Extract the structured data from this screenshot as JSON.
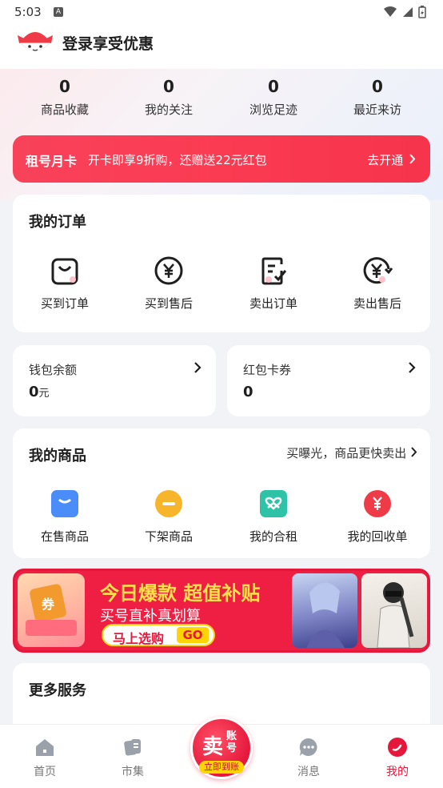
{
  "status": {
    "time": "5:03",
    "badge": "A"
  },
  "header": {
    "title": "登录享受优惠"
  },
  "stats": [
    {
      "value": "0",
      "label": "商品收藏"
    },
    {
      "value": "0",
      "label": "我的关注"
    },
    {
      "value": "0",
      "label": "浏览足迹"
    },
    {
      "value": "0",
      "label": "最近来访"
    }
  ],
  "vip": {
    "title": "租号月卡",
    "desc": "开卡即享9折购，还赠送22元红包",
    "button": "去开通"
  },
  "orders": {
    "title": "我的订单",
    "items": [
      {
        "label": "买到订单",
        "icon": "shopping-bag-icon"
      },
      {
        "label": "买到售后",
        "icon": "yuan-circle-icon"
      },
      {
        "label": "卖出订单",
        "icon": "document-check-icon"
      },
      {
        "label": "卖出售后",
        "icon": "yuan-refresh-icon"
      }
    ]
  },
  "wallet": {
    "balance": {
      "label": "钱包余额",
      "value": "0",
      "unit": "元"
    },
    "coupon": {
      "label": "红包卡券",
      "value": "0"
    }
  },
  "goods": {
    "title": "我的商品",
    "link": "买曝光，商品更快卖出",
    "items": [
      {
        "label": "在售商品",
        "icon": "on-sale-icon",
        "color": "#4a8df8"
      },
      {
        "label": "下架商品",
        "icon": "off-shelf-icon",
        "color": "#f7b52c"
      },
      {
        "label": "我的合租",
        "icon": "shared-rent-icon",
        "color": "#2ec2a6"
      },
      {
        "label": "我的回收单",
        "icon": "recycle-order-icon",
        "color": "#ee3b47"
      }
    ]
  },
  "banner": {
    "title": "今日爆款 超值补贴",
    "subtitle": "买号直补真划算",
    "button": "马上选购",
    "go": "GO",
    "coupon_text": "券"
  },
  "more": {
    "title": "更多服务"
  },
  "tabbar": {
    "items": [
      {
        "label": "首页",
        "icon": "home-icon"
      },
      {
        "label": "市集",
        "icon": "market-icon"
      },
      {
        "label": "消息",
        "icon": "message-icon"
      },
      {
        "label": "我的",
        "icon": "profile-icon"
      }
    ],
    "sell": {
      "main": "卖",
      "small": "账号",
      "tag": "立即到账"
    },
    "active_color": "#e5173b"
  }
}
